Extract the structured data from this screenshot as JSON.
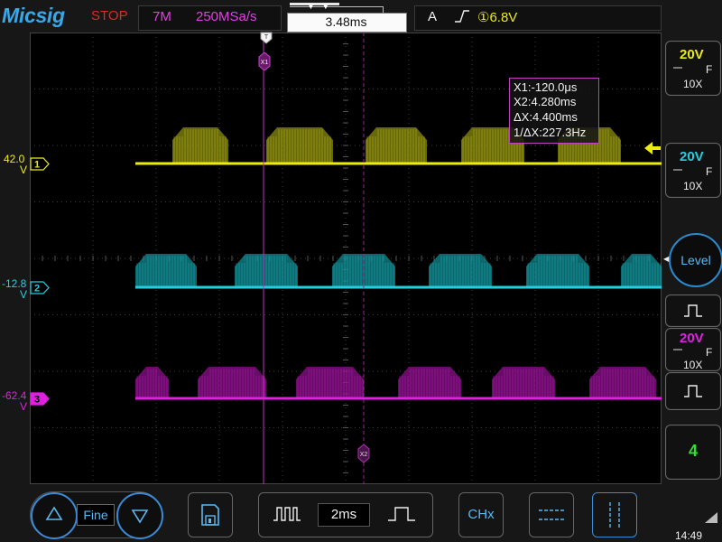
{
  "header": {
    "brand": "Micsig",
    "run_state": "STOP",
    "memory_depth": "7M",
    "sample_rate": "250MSa/s",
    "trigger_delay": "3.48ms",
    "trigger_mode": "A",
    "trigger_source_level": "①6.8V"
  },
  "channels": [
    {
      "id": "1",
      "offset": "42.0",
      "unit": "V",
      "color": "#ecec10"
    },
    {
      "id": "2",
      "offset": "-12.8",
      "unit": "V",
      "color": "#20d0e0"
    },
    {
      "id": "3",
      "offset": "-62.4",
      "unit": "V",
      "color": "#e020e0"
    }
  ],
  "cursors": {
    "x1_label": "X1",
    "x2_label": "X2",
    "readout": {
      "x1": "X1:-120.0μs",
      "x2": "X2:4.280ms",
      "dx": "ΔX:4.400ms",
      "inv_dx": "1/ΔX:227.3Hz"
    }
  },
  "right_panel": {
    "ch1": {
      "volts_div": "20V",
      "coupling": "F",
      "probe": "10X"
    },
    "ch2": {
      "volts_div": "20V",
      "coupling": "F",
      "probe": "10X"
    },
    "level_label": "Level",
    "ch3": {
      "volts_div": "20V",
      "coupling": "F",
      "probe": "10X"
    },
    "channel_count": "4"
  },
  "bottom_bar": {
    "fine_label": "Fine",
    "timebase": "2ms",
    "chx_label": "CHx",
    "clock": "14:49"
  },
  "colors": {
    "ch1": "#ecec10",
    "ch2": "#20d0e0",
    "ch3": "#e020e0",
    "accent": "#38a8e8",
    "stop": "#e02828",
    "green": "#30e030"
  }
}
